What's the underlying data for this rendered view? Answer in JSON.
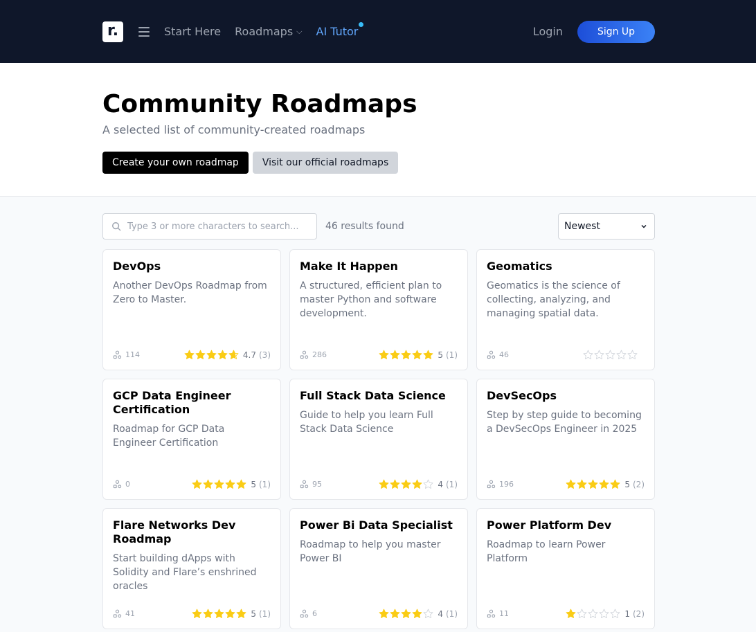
{
  "nav": {
    "logo_letter": "r.",
    "start_here": "Start Here",
    "roadmaps": "Roadmaps",
    "ai_tutor": "AI Tutor",
    "login": "Login",
    "signup": "Sign Up"
  },
  "hero": {
    "title": "Community Roadmaps",
    "subtitle": "A selected list of community-created roadmaps",
    "create_btn": "Create your own roadmap",
    "official_btn": "Visit our official roadmaps"
  },
  "toolbar": {
    "search_placeholder": "Type 3 or more characters to search...",
    "results": "46 results found",
    "sort_selected": "Newest"
  },
  "colors": {
    "star": "#facc15",
    "accent": "#3b82f6",
    "nav_bg": "#0f172a"
  },
  "cards": [
    {
      "title": "DevOps",
      "desc": "Another DevOps Roadmap from Zero to Master.",
      "count": "114",
      "rating": 4.7,
      "rating_text": "4.7",
      "reviews": "(3)"
    },
    {
      "title": "Make It Happen",
      "desc": "A structured, efficient plan to master Python and software development.",
      "count": "286",
      "rating": 5,
      "rating_text": "5",
      "reviews": "(1)"
    },
    {
      "title": "Geomatics",
      "desc": "Geomatics is the science of collecting, analyzing, and managing spatial data.",
      "count": "46",
      "rating": 0,
      "rating_text": "",
      "reviews": ""
    },
    {
      "title": "GCP Data Engineer Certification",
      "desc": "Roadmap for GCP Data Engineer Certification",
      "count": "0",
      "rating": 5,
      "rating_text": "5",
      "reviews": "(1)"
    },
    {
      "title": "Full Stack Data Science",
      "desc": "Guide to help you learn Full Stack Data Science",
      "count": "95",
      "rating": 4,
      "rating_text": "4",
      "reviews": "(1)"
    },
    {
      "title": "DevSecOps",
      "desc": "Step by step guide to becoming a DevSecOps Engineer in 2025",
      "count": "196",
      "rating": 5,
      "rating_text": "5",
      "reviews": "(2)"
    },
    {
      "title": "Flare Networks Dev Roadmap",
      "desc": "Start building dApps with Solidity and Flare’s enshrined oracles",
      "count": "41",
      "rating": 5,
      "rating_text": "5",
      "reviews": "(1)"
    },
    {
      "title": "Power Bi Data Specialist",
      "desc": "Roadmap to help you master Power BI",
      "count": "6",
      "rating": 4,
      "rating_text": "4",
      "reviews": "(1)"
    },
    {
      "title": "Power Platform Dev",
      "desc": "Roadmap to learn Power Platform",
      "count": "11",
      "rating": 1,
      "rating_text": "1",
      "reviews": "(2)"
    }
  ]
}
